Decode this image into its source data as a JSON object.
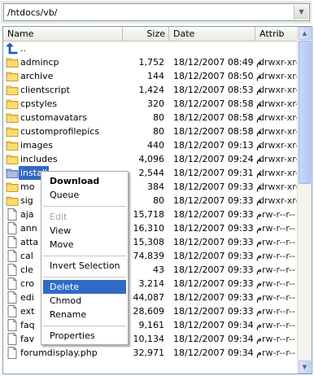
{
  "path": {
    "value": "/htdocs/vb/"
  },
  "columns": {
    "name": "Name",
    "size": "Size",
    "date": "Date",
    "attrib": "Attrib"
  },
  "files": [
    {
      "name": "..",
      "size": "",
      "date": "",
      "attrib": "",
      "type": "up"
    },
    {
      "name": "admincp",
      "size": "1,752",
      "date": "18/12/2007 08:49 م",
      "attrib": "drwxr-xr-x",
      "type": "folder"
    },
    {
      "name": "archive",
      "size": "144",
      "date": "18/12/2007 08:50 م",
      "attrib": "drwxr-xr-x",
      "type": "folder"
    },
    {
      "name": "clientscript",
      "size": "1,424",
      "date": "18/12/2007 08:53 م",
      "attrib": "drwxr-xr-x",
      "type": "folder"
    },
    {
      "name": "cpstyles",
      "size": "320",
      "date": "18/12/2007 08:58 م",
      "attrib": "drwxr-xr-x",
      "type": "folder"
    },
    {
      "name": "customavatars",
      "size": "80",
      "date": "18/12/2007 08:58 م",
      "attrib": "drwxr-xr-x",
      "type": "folder"
    },
    {
      "name": "customprofilepics",
      "size": "80",
      "date": "18/12/2007 08:58 م",
      "attrib": "drwxr-xr-x",
      "type": "folder"
    },
    {
      "name": "images",
      "size": "440",
      "date": "18/12/2007 09:13 م",
      "attrib": "drwxr-xr-x",
      "type": "folder"
    },
    {
      "name": "includes",
      "size": "4,096",
      "date": "18/12/2007 09:24 م",
      "attrib": "drwxr-xr-x",
      "type": "folder"
    },
    {
      "name": "install",
      "size": "2,544",
      "date": "18/12/2007 09:31 م",
      "attrib": "drwxr-xr-x",
      "type": "folder-selected"
    },
    {
      "name": "mo",
      "size": "384",
      "date": "18/12/2007 09:33 م",
      "attrib": "drwxr-xr-x",
      "type": "folder"
    },
    {
      "name": "sig",
      "size": "80",
      "date": "18/12/2007 09:33 م",
      "attrib": "drwxr-xr-x",
      "type": "folder"
    },
    {
      "name": "aja",
      "size": "15,718",
      "date": "18/12/2007 09:33 م",
      "attrib": "-rw-r--r--",
      "type": "file"
    },
    {
      "name": "ann",
      "size": "16,310",
      "date": "18/12/2007 09:33 م",
      "attrib": "-rw-r--r--",
      "type": "file"
    },
    {
      "name": "atta",
      "size": "15,308",
      "date": "18/12/2007 09:33 م",
      "attrib": "-rw-r--r--",
      "type": "file"
    },
    {
      "name": "cal",
      "size": "74,839",
      "date": "18/12/2007 09:33 م",
      "attrib": "-rw-r--r--",
      "type": "file"
    },
    {
      "name": "cle",
      "size": "43",
      "date": "18/12/2007 09:33 م",
      "attrib": "-rw-r--r--",
      "type": "file"
    },
    {
      "name": "cro",
      "size": "3,214",
      "date": "18/12/2007 09:33 م",
      "attrib": "-rw-r--r--",
      "type": "file"
    },
    {
      "name": "edi",
      "size": "44,087",
      "date": "18/12/2007 09:33 م",
      "attrib": "-rw-r--r--",
      "type": "file"
    },
    {
      "name": "ext",
      "size": "28,609",
      "date": "18/12/2007 09:33 م",
      "attrib": "-rw-r--r--",
      "type": "file"
    },
    {
      "name": "faq",
      "size": "9,161",
      "date": "18/12/2007 09:34 م",
      "attrib": "-rw-r--r--",
      "type": "file"
    },
    {
      "name": "fav",
      "size": "10,134",
      "date": "18/12/2007 09:34 م",
      "attrib": "-rw-r--r--",
      "type": "file"
    },
    {
      "name": "forumdisplay.php",
      "size": "32,971",
      "date": "18/12/2007 09:34 م",
      "attrib": "-rw-r--r--",
      "type": "file"
    }
  ],
  "context_menu": {
    "download": "Download",
    "queue": "Queue",
    "edit": "Edit",
    "view": "View",
    "move": "Move",
    "invert_selection": "Invert Selection",
    "delete": "Delete",
    "chmod": "Chmod",
    "rename": "Rename",
    "properties": "Properties"
  },
  "colors": {
    "selection": "#316ac5",
    "border": "#7f9db9",
    "folder": "#f5c94a"
  }
}
